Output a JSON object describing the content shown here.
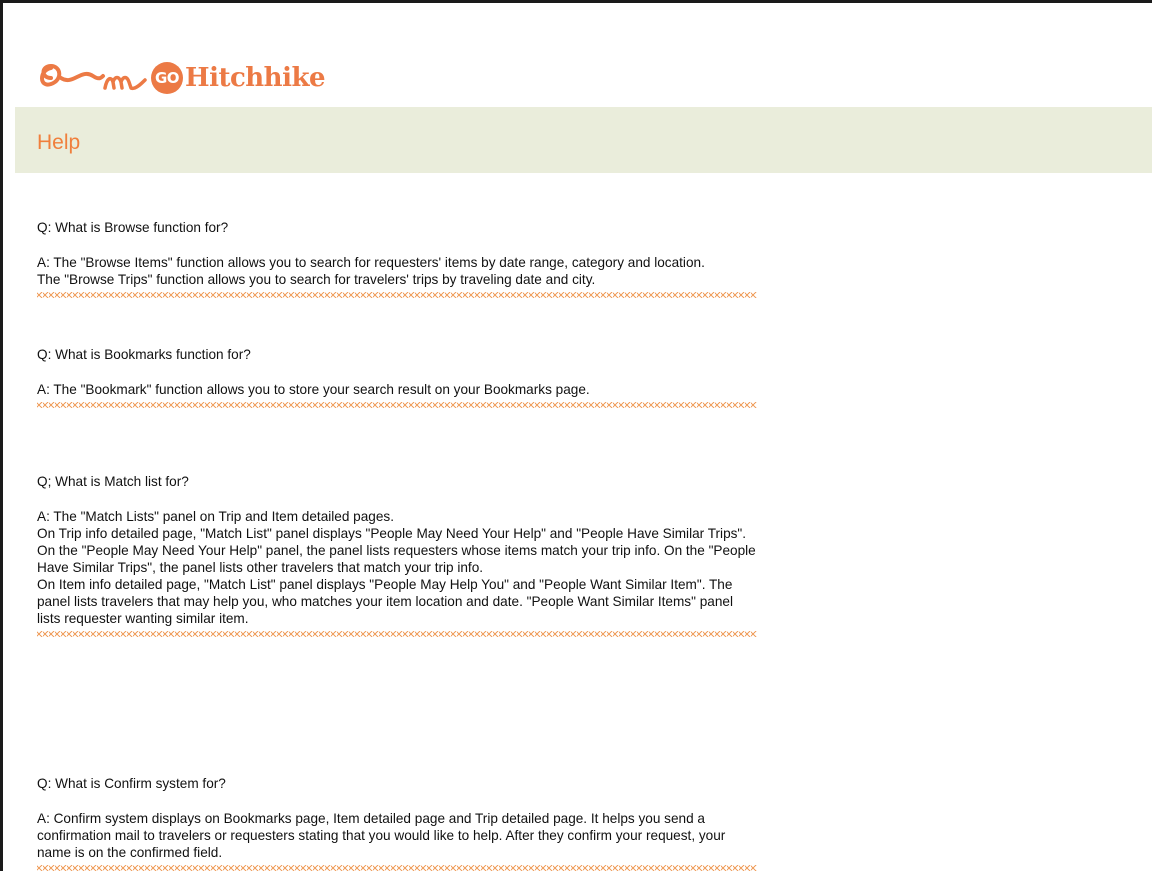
{
  "brand": {
    "go_badge": "GO",
    "name": "Hitchhike"
  },
  "header": {
    "title": "Help"
  },
  "colors": {
    "brand_orange": "#ec7a45",
    "header_bar": "#eaeddb",
    "divider": "#f0a060"
  },
  "faq": [
    {
      "question": "Q: What is Browse function for?",
      "answer": [
        "A: The \"Browse Items\" function allows you to search for requesters' items by date range, category and location.",
        "The \"Browse Trips\" function allows you to search for travelers' trips by traveling date and city."
      ]
    },
    {
      "question": "Q: What is Bookmarks function for?",
      "answer": [
        "A: The \"Bookmark\" function allows you to store your search result on your Bookmarks page."
      ]
    },
    {
      "question": "Q; What is Match list for?",
      "answer": [
        "A: The \"Match Lists\" panel on Trip and Item detailed pages.",
        "On Trip info detailed page, \"Match List\" panel displays \"People May Need Your Help\" and \"People Have Similar Trips\". On the \"People May Need Your Help\" panel, the panel lists requesters whose items match your trip info. On the \"People Have Similar Trips\", the panel lists other travelers that match your trip info.",
        "On Item info detailed page, \"Match List\" panel displays \"People May Help You\" and \"People Want Similar Item\". The panel lists travelers that may help you, who matches your item location and date. \"People Want Similar Items\" panel lists requester wanting similar item."
      ]
    },
    {
      "question": "Q: What is Confirm system for?",
      "answer": [
        "A: Confirm system displays on Bookmarks page, Item detailed page and Trip detailed page. It helps you send a confirmation mail to travelers or requesters stating that you would like to help. After they confirm your request, your name is on the confirmed field."
      ]
    }
  ]
}
